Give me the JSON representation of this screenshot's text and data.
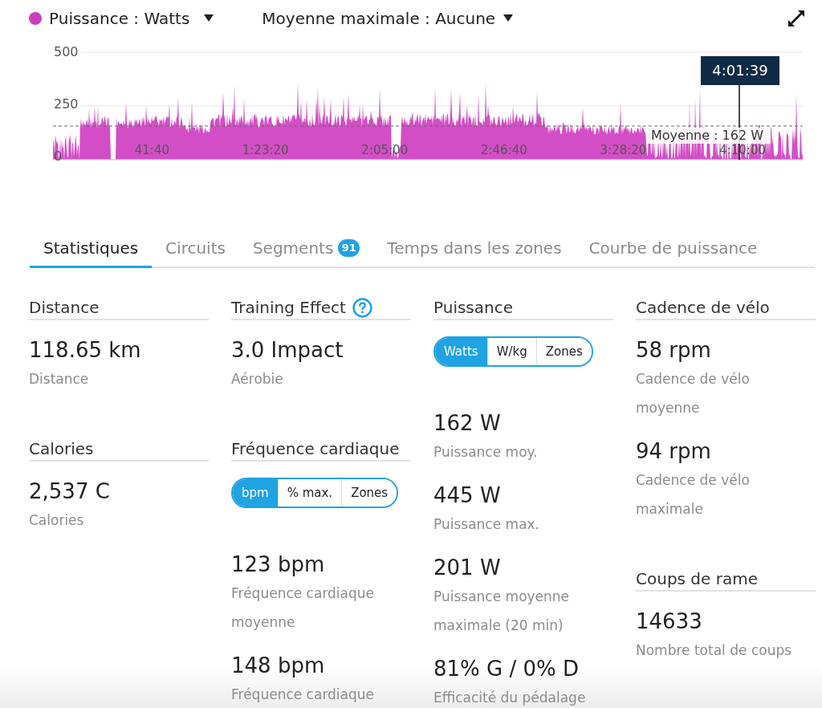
{
  "chart_header": {
    "series_dropdown": "Puissance : Watts",
    "average_dropdown": "Moyenne maximale : Aucune"
  },
  "chart": {
    "y_ticks": [
      "500",
      "250",
      "0"
    ],
    "x_ticks": [
      "41:40",
      "1:23:20",
      "2:05:00",
      "2:46:40",
      "3:28:20",
      "4:10:00"
    ],
    "cursor_time": "4:01:39",
    "average_label": "Moyenne : 162 W"
  },
  "tabs": [
    {
      "label": "Statistiques",
      "selected": true
    },
    {
      "label": "Circuits",
      "selected": false
    },
    {
      "label": "Segments",
      "selected": false,
      "badge": "91"
    },
    {
      "label": "Temps dans les zones",
      "selected": false
    },
    {
      "label": "Courbe de puissance",
      "selected": false
    }
  ],
  "stats_columns": [
    {
      "blocks": [
        {
          "kind": "header",
          "title": "Distance"
        },
        {
          "kind": "stat",
          "value": "118.65 km",
          "label": "Distance"
        },
        {
          "kind": "header",
          "title": "Calories"
        },
        {
          "kind": "stat",
          "value": "2,537 C",
          "label": "Calories"
        }
      ]
    },
    {
      "blocks": [
        {
          "kind": "header",
          "title": "Training Effect",
          "help": true
        },
        {
          "kind": "stat",
          "value": "3.0 Impact",
          "label": "Aérobie"
        },
        {
          "kind": "header",
          "title": "Fréquence cardiaque"
        },
        {
          "kind": "toggle",
          "options": [
            {
              "label": "bpm",
              "selected": true
            },
            {
              "label": "% max.",
              "selected": false
            },
            {
              "label": "Zones",
              "selected": false
            }
          ]
        },
        {
          "kind": "stat",
          "value": "123 bpm",
          "label": "Fréquence cardiaque moyenne"
        },
        {
          "kind": "stat",
          "value": "148 bpm",
          "label": "Fréquence cardiaque"
        }
      ]
    },
    {
      "blocks": [
        {
          "kind": "header",
          "title": "Puissance"
        },
        {
          "kind": "toggle",
          "options": [
            {
              "label": "Watts",
              "selected": true
            },
            {
              "label": "W/kg",
              "selected": false
            },
            {
              "label": "Zones",
              "selected": false
            }
          ]
        },
        {
          "kind": "stat",
          "value": "162 W",
          "label": "Puissance moy."
        },
        {
          "kind": "stat",
          "value": "445 W",
          "label": "Puissance max."
        },
        {
          "kind": "stat",
          "value": "201 W",
          "label": "Puissance moyenne maximale (20 min)"
        },
        {
          "kind": "stat",
          "value": "81% G / 0% D",
          "label": "Efficacité du pédalage"
        }
      ]
    },
    {
      "blocks": [
        {
          "kind": "header",
          "title": "Cadence de vélo"
        },
        {
          "kind": "stat",
          "value": "58 rpm",
          "label": "Cadence de vélo moyenne"
        },
        {
          "kind": "stat",
          "value": "94 rpm",
          "label": "Cadence de vélo maximale"
        },
        {
          "kind": "header",
          "title": "Coups de rame"
        },
        {
          "kind": "stat",
          "value": "14633",
          "label": "Nombre total de coups"
        }
      ]
    }
  ]
}
